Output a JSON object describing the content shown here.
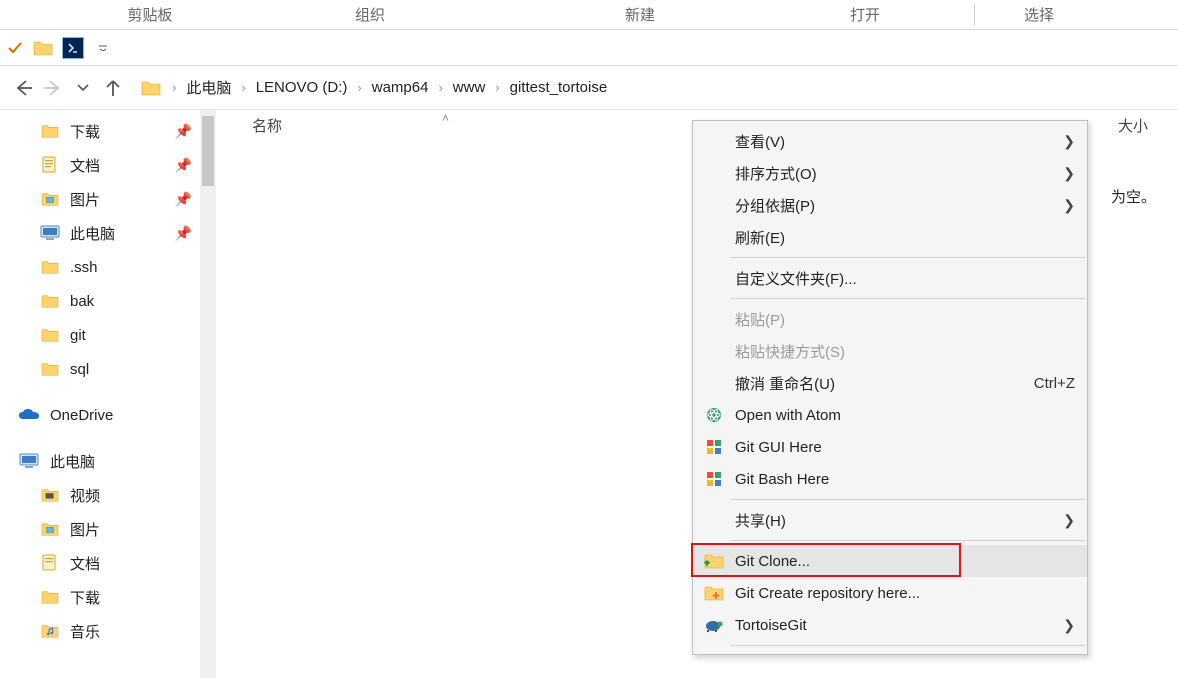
{
  "ribbon": {
    "items": [
      "剪贴板",
      "组织",
      "新建",
      "打开",
      "选择"
    ]
  },
  "breadcrumbs": {
    "items": [
      "此电脑",
      "LENOVO (D:)",
      "wamp64",
      "www",
      "gittest_tortoise"
    ]
  },
  "columns": {
    "name": "名称",
    "size": "大小"
  },
  "empty_msg_suffix": "为空。",
  "sidebar": {
    "pinned": [
      {
        "label": "下载",
        "icon": "folder"
      },
      {
        "label": "文档",
        "icon": "doc"
      },
      {
        "label": "图片",
        "icon": "pic"
      },
      {
        "label": "此电脑",
        "icon": "pc"
      }
    ],
    "recent": [
      {
        "label": ".ssh"
      },
      {
        "label": "bak"
      },
      {
        "label": "git"
      },
      {
        "label": "sql"
      }
    ],
    "onedrive": "OneDrive",
    "thispc_head": "此电脑",
    "thispc": [
      {
        "label": "视频",
        "icon": "video"
      },
      {
        "label": "图片",
        "icon": "pic"
      },
      {
        "label": "文档",
        "icon": "doc"
      },
      {
        "label": "下载",
        "icon": "folder"
      },
      {
        "label": "音乐",
        "icon": "music"
      }
    ]
  },
  "context_menu": {
    "items": [
      {
        "label": "查看(V)",
        "arrow": true
      },
      {
        "label": "排序方式(O)",
        "arrow": true
      },
      {
        "label": "分组依据(P)",
        "arrow": true
      },
      {
        "label": "刷新(E)"
      }
    ],
    "customize": "自定义文件夹(F)...",
    "paste": "粘贴(P)",
    "paste_shortcut": "粘贴快捷方式(S)",
    "undo_rename": "撤消 重命名(U)",
    "undo_sc": "Ctrl+Z",
    "atom": "Open with Atom",
    "git_gui": "Git GUI Here",
    "git_bash": "Git Bash Here",
    "share": "共享(H)",
    "git_clone": "Git Clone...",
    "git_create": "Git Create repository here...",
    "tortoise": "TortoiseGit"
  }
}
